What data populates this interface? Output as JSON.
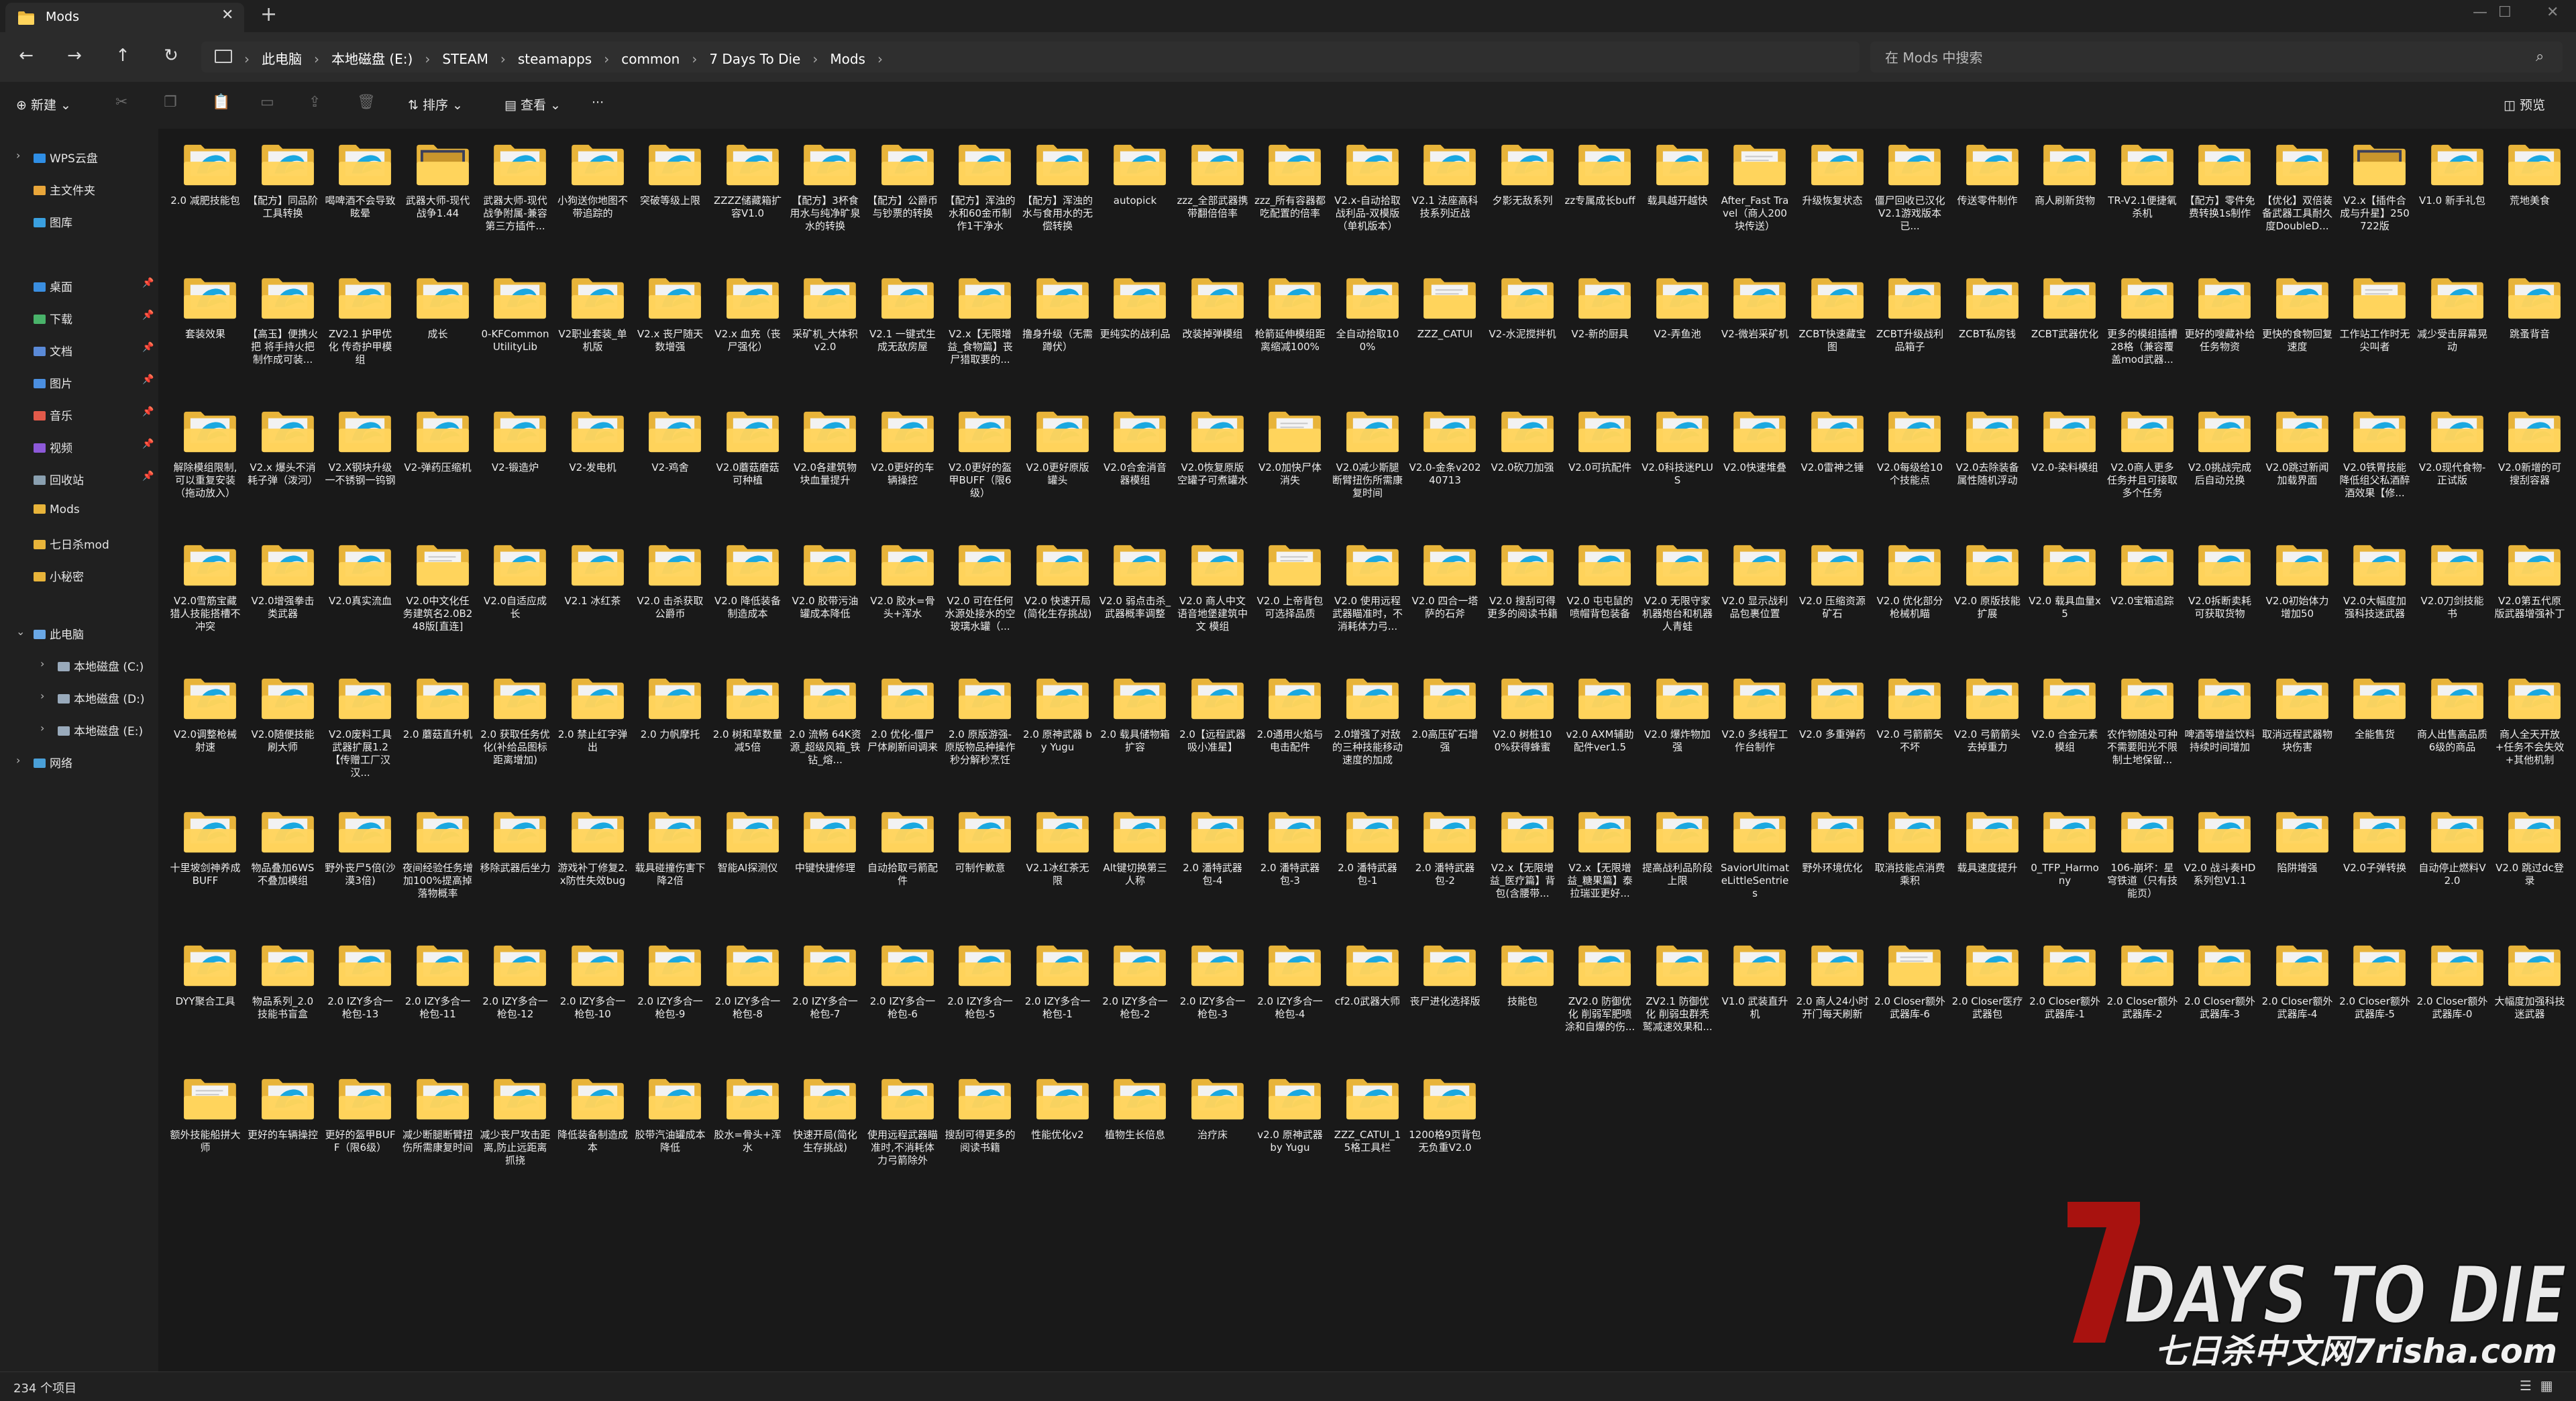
{
  "window": {
    "tab_title": "Mods",
    "tab_close": "✕",
    "new_tab": "+",
    "controls": [
      "—",
      "☐",
      "✕"
    ]
  },
  "address": {
    "crumbs": [
      "此电脑",
      "本地磁盘 (E:)",
      "STEAM",
      "steamapps",
      "common",
      "7 Days To Die",
      "Mods"
    ],
    "search_placeholder": "在 Mods 中搜索"
  },
  "toolbar": {
    "new_label": "新建",
    "sort_label": "排序",
    "view_label": "查看",
    "more_label": "···",
    "preview_label": "预览"
  },
  "sidebar": {
    "items": [
      {
        "label": "WPS云盘",
        "kind": "cloud"
      },
      {
        "label": "主文件夹",
        "kind": "home"
      },
      {
        "label": "图库",
        "kind": "gallery"
      },
      {
        "label": "桌面",
        "kind": "desktop",
        "pinned": true
      },
      {
        "label": "下载",
        "kind": "download",
        "pinned": true
      },
      {
        "label": "文档",
        "kind": "docs",
        "pinned": true
      },
      {
        "label": "图片",
        "kind": "pictures",
        "pinned": true
      },
      {
        "label": "音乐",
        "kind": "music",
        "pinned": true
      },
      {
        "label": "视频",
        "kind": "video",
        "pinned": true
      },
      {
        "label": "回收站",
        "kind": "recycle",
        "pinned": true
      },
      {
        "label": "Mods",
        "kind": "folder"
      },
      {
        "label": "七日杀mod",
        "kind": "folder"
      },
      {
        "label": "小秘密",
        "kind": "folder"
      },
      {
        "label": "此电脑",
        "kind": "pc"
      },
      {
        "label": "本地磁盘 (C:)",
        "kind": "drive"
      },
      {
        "label": "本地磁盘 (D:)",
        "kind": "drive"
      },
      {
        "label": "本地磁盘 (E:)",
        "kind": "drive"
      },
      {
        "label": "网络",
        "kind": "network"
      }
    ]
  },
  "folders": [
    {
      "name": "2.0 减肥技能包",
      "t": "e"
    },
    {
      "name": "【配方】同品阶工具转换",
      "t": "e"
    },
    {
      "name": "喝啤酒不会导致眩晕",
      "t": "e"
    },
    {
      "name": "武器大师-现代战争1.44",
      "t": "img"
    },
    {
      "name": "武器大师-现代战争附属-兼容第三方插件...",
      "t": "e"
    },
    {
      "name": "小狗送你地图不带追踪的",
      "t": "e"
    },
    {
      "name": "突破等级上限",
      "t": "e"
    },
    {
      "name": "ZZZZ储藏箱扩容V1.0",
      "t": "e"
    },
    {
      "name": "【配方】3杯食用水与纯净旷泉水的转换",
      "t": "e"
    },
    {
      "name": "【配方】公爵币与钞票的转换",
      "t": "e"
    },
    {
      "name": "【配方】浑浊的水和60金币制作1干净水",
      "t": "e"
    },
    {
      "name": "【配方】浑浊的水与食用水的无偿转换",
      "t": "e"
    },
    {
      "name": "autopick",
      "t": "e"
    },
    {
      "name": "zzz_全部武器携带翻倍倍率",
      "t": "e"
    },
    {
      "name": "zzz_所有容器都吃配置的倍率",
      "t": "e"
    },
    {
      "name": "V2.x-自动拾取战利品-双模版（单机版本）",
      "t": "e"
    },
    {
      "name": "V2.1 法座高科技系列近战",
      "t": "e"
    },
    {
      "name": "夕影无敌系列",
      "t": "e"
    },
    {
      "name": "zz专属成长buff",
      "t": "e"
    },
    {
      "name": "载具越开越快",
      "t": "e"
    },
    {
      "name": "After_Fast Travel（商人200块传送）",
      "t": "d"
    },
    {
      "name": "升级恢复状态",
      "t": "e"
    },
    {
      "name": "僵尸回收已汉化V2.1游戏版本 已...",
      "t": "e"
    },
    {
      "name": "传送零件制作",
      "t": "e"
    },
    {
      "name": "商人刷新货物",
      "t": "e"
    },
    {
      "name": "TR-V2.1便捷氧杀机",
      "t": "e"
    },
    {
      "name": "【配方】零件免费转换1s制作",
      "t": "e"
    },
    {
      "name": "【优化】双倍装备武器工具耐久度DoubleD...",
      "t": "e"
    },
    {
      "name": "V2.x【插件合成与升星】250722版",
      "t": "img"
    },
    {
      "name": "V1.0 新手礼包",
      "t": "e"
    },
    {
      "name": "荒地美食",
      "t": "e"
    },
    {
      "name": "套装效果",
      "t": "e"
    },
    {
      "name": "【高玉】便携火把 将手持火把制作成可装...",
      "t": "e"
    },
    {
      "name": "ZV2.1 护甲优化 传奇护甲模组",
      "t": "e"
    },
    {
      "name": "成长",
      "t": "e"
    },
    {
      "name": "0-KFCommonUtilityLib",
      "t": "e"
    },
    {
      "name": "V2职业套装_单机版",
      "t": "e"
    },
    {
      "name": "V2.x 丧尸随天数增强",
      "t": "e"
    },
    {
      "name": "V2.x 血充（丧尸强化）",
      "t": "e"
    },
    {
      "name": "采矿机_大体积 v2.0",
      "t": "e"
    },
    {
      "name": "V2.1 一键式生成无敌房屋",
      "t": "e"
    },
    {
      "name": "V2.x【无限增益_食物篇】丧尸猎取要的...",
      "t": "e"
    },
    {
      "name": "撸身升级（无需蹲伏）",
      "t": "e"
    },
    {
      "name": "更纯实的战利品",
      "t": "e"
    },
    {
      "name": "改装掉弹模组",
      "t": "e"
    },
    {
      "name": "枪箭延伸模组距离缩减100%",
      "t": "e"
    },
    {
      "name": "全自动拾取100%",
      "t": "e"
    },
    {
      "name": "ZZZ_CATUI",
      "t": "d"
    },
    {
      "name": "V2-水泥搅拌机",
      "t": "e"
    },
    {
      "name": "V2-新的厨具",
      "t": "e"
    },
    {
      "name": "V2-弄鱼池",
      "t": "e"
    },
    {
      "name": "V2-微岩采矿机",
      "t": "e"
    },
    {
      "name": "ZCBT快速藏宝图",
      "t": "e"
    },
    {
      "name": "ZCBT升级战利品箱子",
      "t": "e"
    },
    {
      "name": "ZCBT私房钱",
      "t": "e"
    },
    {
      "name": "ZCBT武器优化",
      "t": "e"
    },
    {
      "name": "更多的模组插槽28格（兼容覆盖mod武器...",
      "t": "e"
    },
    {
      "name": "更好的嗖藏补给任务物资",
      "t": "e"
    },
    {
      "name": "更快的食物回复速度",
      "t": "e"
    },
    {
      "name": "工作站工作时无尖叫者",
      "t": "d"
    },
    {
      "name": "减少受击屏幕晃动",
      "t": "e"
    },
    {
      "name": "跳蚤背音",
      "t": "e"
    },
    {
      "name": "解除模组限制,可以重复安装（拖动放入）",
      "t": "e"
    },
    {
      "name": "V2.x 爆头不消耗子弹（泼河）",
      "t": "e"
    },
    {
      "name": "V2.X钢块升级一不锈钢一钨钢",
      "t": "e"
    },
    {
      "name": "V2-弹药压缩机",
      "t": "e"
    },
    {
      "name": "V2-锻造炉",
      "t": "e"
    },
    {
      "name": "V2-发电机",
      "t": "e"
    },
    {
      "name": "V2-鸡舍",
      "t": "e"
    },
    {
      "name": "V2.0蘑菇磨菇可种植",
      "t": "e"
    },
    {
      "name": "V2.0各建筑物块血量提升",
      "t": "e"
    },
    {
      "name": "V2.0更好的车辆操控",
      "t": "e"
    },
    {
      "name": "V2.0更好的盔甲BUFF（限6级）",
      "t": "e"
    },
    {
      "name": "V2.0更好原版罐头",
      "t": "e"
    },
    {
      "name": "V2.0合金消音器模组",
      "t": "e"
    },
    {
      "name": "V2.0恢复原版空罐子可煮罐水",
      "t": "e"
    },
    {
      "name": "V2.0加快尸体消失",
      "t": "d"
    },
    {
      "name": "V2.0减少斯腿断臂扭伤所需康复时间",
      "t": "e"
    },
    {
      "name": "V2.0-金条v20240713",
      "t": "e"
    },
    {
      "name": "V2.0砍刀加强",
      "t": "e"
    },
    {
      "name": "V2.0可抗配件",
      "t": "e"
    },
    {
      "name": "V2.0科技迷PLUS",
      "t": "e"
    },
    {
      "name": "V2.0快速堆叠",
      "t": "e"
    },
    {
      "name": "V2.0雷神之锤",
      "t": "e"
    },
    {
      "name": "V2.0每级给10个技能点",
      "t": "e"
    },
    {
      "name": "V2.0去除装备属性随机浮动",
      "t": "e"
    },
    {
      "name": "V2.0-染料模组",
      "t": "e"
    },
    {
      "name": "V2.0商人更多任务并且可接取多个任务",
      "t": "e"
    },
    {
      "name": "V2.0挑战完成后自动兑换",
      "t": "e"
    },
    {
      "name": "V2.0跳过新闻加载界面",
      "t": "e"
    },
    {
      "name": "V2.0铁胃技能降低组父私酒醉酒效果【修...",
      "t": "e"
    },
    {
      "name": "V2.0现代食物-正试版",
      "t": "e"
    },
    {
      "name": "V2.0新增的可搜刮容器",
      "t": "e"
    },
    {
      "name": "V2.0雪筋宝藏猎人技能搭槽不冲突",
      "t": "e"
    },
    {
      "name": "V2.0增强拳击类武器",
      "t": "e"
    },
    {
      "name": "V2.0真实流血",
      "t": "e"
    },
    {
      "name": "V2.0中文化任务建筑名2.0B248版[直连]",
      "t": "d"
    },
    {
      "name": "V2.0自适应成长",
      "t": "e"
    },
    {
      "name": "V2.1 冰红茶",
      "t": "e"
    },
    {
      "name": "V2.0 击杀获取公爵币",
      "t": "e"
    },
    {
      "name": "V2.0 降低装备制造成本",
      "t": "e"
    },
    {
      "name": "V2.0 胶带污油罐成本降低",
      "t": "e"
    },
    {
      "name": "V2.0 胶水=骨头+浑水",
      "t": "e"
    },
    {
      "name": "V2.0 可在任何水源处接水的空玻璃水罐（...",
      "t": "e"
    },
    {
      "name": "V2.0 快速开局(简化生存挑战)",
      "t": "e"
    },
    {
      "name": "V2.0 弱点击杀_武器概率调整",
      "t": "e"
    },
    {
      "name": "V2.0 商人中文语音地堡建筑中文 模组",
      "t": "e"
    },
    {
      "name": "V2.0 上帝背包可选择品质",
      "t": "d"
    },
    {
      "name": "V2.0 使用远程武器瞄准时，不消耗体力弓...",
      "t": "e"
    },
    {
      "name": "V2.0 四合一塔萨的石斧",
      "t": "e"
    },
    {
      "name": "V2.0 搜刮可得更多的阅读书籍",
      "t": "e"
    },
    {
      "name": "V2.0 屯屯鼠的喷帽背包装备",
      "t": "e"
    },
    {
      "name": "V2.0 无限守家机器炮台和机器人青蛙",
      "t": "e"
    },
    {
      "name": "V2.0 显示战利品包裹位置",
      "t": "e"
    },
    {
      "name": "V2.0 压缩资源矿石",
      "t": "e"
    },
    {
      "name": "V2.0 优化部分枪械机瞄",
      "t": "e"
    },
    {
      "name": "V2.0 原版技能扩展",
      "t": "e"
    },
    {
      "name": "V2.0 载具血量x5",
      "t": "e"
    },
    {
      "name": "V2.0宝箱追踪",
      "t": "e"
    },
    {
      "name": "V2.0拆断卖耗可获取货物",
      "t": "e"
    },
    {
      "name": "V2.0初始体力增加50",
      "t": "e"
    },
    {
      "name": "V2.0大幅度加强科技迷武器",
      "t": "e"
    },
    {
      "name": "V2.0刀剑技能书",
      "t": "e"
    },
    {
      "name": "V2.0第五代原版武器增强补丁",
      "t": "e"
    },
    {
      "name": "V2.0调整枪械射速",
      "t": "e"
    },
    {
      "name": "V2.0随便技能刷大师",
      "t": "e"
    },
    {
      "name": "V2.0废料工具武器扩展1.2【传赠工厂汉汉...",
      "t": "e"
    },
    {
      "name": "2.0 蘑菇直升机",
      "t": "e"
    },
    {
      "name": "2.0 获取任务优化(补给品图标距离增加)",
      "t": "e"
    },
    {
      "name": "2.0 禁止红字弹出",
      "t": "e"
    },
    {
      "name": "2.0 力帆摩托",
      "t": "e"
    },
    {
      "name": "2.0 树和草数量减5倍",
      "t": "e"
    },
    {
      "name": "2.0 流畅 64K资源_超级风箱_铁钻_熔...",
      "t": "e"
    },
    {
      "name": "2.0 优化-僵尸尸体刷新间调来",
      "t": "e"
    },
    {
      "name": "2.0 原版游强-原版物品种操作秒分解秒烹饪",
      "t": "e"
    },
    {
      "name": "2.0 原神武器 by Yugu",
      "t": "e"
    },
    {
      "name": "2.0 载具储物箱扩容",
      "t": "e"
    },
    {
      "name": "2.0【远程武器吸小准星】",
      "t": "e"
    },
    {
      "name": "2.0通用火焰与电击配件",
      "t": "e"
    },
    {
      "name": "2.0增强了对敌的三种技能移动速度的加成",
      "t": "e"
    },
    {
      "name": "2.0高压矿石增强",
      "t": "e"
    },
    {
      "name": "V2.0 树桩100%获得蜂蜜",
      "t": "e"
    },
    {
      "name": "v2.0 AXM辅助配件ver1.5",
      "t": "e"
    },
    {
      "name": "V2.0 爆炸物加强",
      "t": "e"
    },
    {
      "name": "V2.0 多线程工作台制作",
      "t": "e"
    },
    {
      "name": "V2.0 多重弹药",
      "t": "e"
    },
    {
      "name": "V2.0 弓箭箭矢不坏",
      "t": "e"
    },
    {
      "name": "V2.0 弓箭箭头去掉重力",
      "t": "e"
    },
    {
      "name": "V2.0 合金元素模组",
      "t": "e"
    },
    {
      "name": "农作物随处可种不需要阳光不限制土地保留...",
      "t": "e"
    },
    {
      "name": "啤酒等增益饮料持续时间增加",
      "t": "e"
    },
    {
      "name": "取消远程武器物块伤害",
      "t": "e"
    },
    {
      "name": "全能售货",
      "t": "e"
    },
    {
      "name": "商人出售高品质6级的商品",
      "t": "e"
    },
    {
      "name": "商人全天开放+任务不会失效+其他机制",
      "t": "e"
    },
    {
      "name": "十里坡剑神养成BUFF",
      "t": "e"
    },
    {
      "name": "物品叠加6WS不叠加模组",
      "t": "e"
    },
    {
      "name": "野外丧尸5倍(沙漠3倍)",
      "t": "e"
    },
    {
      "name": "夜间经验任务增加100%提高掉落物概率",
      "t": "e"
    },
    {
      "name": "移除武器后坐力",
      "t": "e"
    },
    {
      "name": "游戏补丁修复2.x防性失效bug",
      "t": "e"
    },
    {
      "name": "载具碰撞伤害下降2倍",
      "t": "e"
    },
    {
      "name": "智能AI探测仪",
      "t": "e"
    },
    {
      "name": "中键快捷修理",
      "t": "e"
    },
    {
      "name": "自动拾取弓箭配件",
      "t": "e"
    },
    {
      "name": "可制作歉意",
      "t": "e"
    },
    {
      "name": "V2.1冰红茶无限",
      "t": "e"
    },
    {
      "name": "Alt键切换第三人称",
      "t": "e"
    },
    {
      "name": "2.0 潘特武器包-4",
      "t": "e"
    },
    {
      "name": "2.0 潘特武器包-3",
      "t": "e"
    },
    {
      "name": "2.0 潘特武器包-1",
      "t": "e"
    },
    {
      "name": "2.0 潘特武器包-2",
      "t": "e"
    },
    {
      "name": "V2.x【无限增益_医疗篇】背包(含腰带...",
      "t": "e"
    },
    {
      "name": "V2.x【无限增益_糖果篇】泰拉瑞亚更好...",
      "t": "e"
    },
    {
      "name": "提高战利品阶段上限",
      "t": "e"
    },
    {
      "name": "SaviorUltimateLittleSentries",
      "t": "e"
    },
    {
      "name": "野外环境优化",
      "t": "e"
    },
    {
      "name": "取消技能点消费乘积",
      "t": "e"
    },
    {
      "name": "载具速度提升",
      "t": "e"
    },
    {
      "name": "0_TFP_Harmony",
      "t": "e"
    },
    {
      "name": "106-崩坏：星穹铁道（只有技能页）",
      "t": "e"
    },
    {
      "name": "V2.0 战斗奏HD系列包V1.1",
      "t": "e"
    },
    {
      "name": "陷阱增强",
      "t": "e"
    },
    {
      "name": "V2.0子弹转换",
      "t": "e"
    },
    {
      "name": "自动停止燃料V2.0",
      "t": "e"
    },
    {
      "name": "V2.0 跳过dc登录",
      "t": "e"
    },
    {
      "name": "DYY聚合工具",
      "t": "e"
    },
    {
      "name": "物品系列_2.0 技能书盲盒",
      "t": "e"
    },
    {
      "name": "2.0 IZY多合一枪包-13",
      "t": "e"
    },
    {
      "name": "2.0 IZY多合一枪包-11",
      "t": "e"
    },
    {
      "name": "2.0 IZY多合一枪包-12",
      "t": "e"
    },
    {
      "name": "2.0 IZY多合一枪包-10",
      "t": "e"
    },
    {
      "name": "2.0 IZY多合一枪包-9",
      "t": "e"
    },
    {
      "name": "2.0 IZY多合一枪包-8",
      "t": "e"
    },
    {
      "name": "2.0 IZY多合一枪包-7",
      "t": "e"
    },
    {
      "name": "2.0 IZY多合一枪包-6",
      "t": "e"
    },
    {
      "name": "2.0 IZY多合一枪包-5",
      "t": "e"
    },
    {
      "name": "2.0 IZY多合一枪包-1",
      "t": "e"
    },
    {
      "name": "2.0 IZY多合一枪包-2",
      "t": "e"
    },
    {
      "name": "2.0 IZY多合一枪包-3",
      "t": "e"
    },
    {
      "name": "2.0 IZY多合一枪包-4",
      "t": "e"
    },
    {
      "name": "cf2.0武器大师",
      "t": "e"
    },
    {
      "name": "丧尸进化选择版",
      "t": "e"
    },
    {
      "name": "技能包",
      "t": "e"
    },
    {
      "name": "ZV2.0 防御优化 削弱军肥喷涂和自爆的伤...",
      "t": "e"
    },
    {
      "name": "ZV2.1 防御优化 削弱虫群秃鹫减速效果和...",
      "t": "e"
    },
    {
      "name": "V1.0 武装直升机",
      "t": "e"
    },
    {
      "name": "2.0 商人24小时开门每天刷新",
      "t": "e"
    },
    {
      "name": "2.0 Closer额外武器库-6",
      "t": "d"
    },
    {
      "name": "2.0 Closer医疗武器包",
      "t": "e"
    },
    {
      "name": "2.0 Closer额外武器库-1",
      "t": "e"
    },
    {
      "name": "2.0 Closer额外武器库-2",
      "t": "e"
    },
    {
      "name": "2.0 Closer额外武器库-3",
      "t": "e"
    },
    {
      "name": "2.0 Closer额外武器库-4",
      "t": "e"
    },
    {
      "name": "2.0 Closer额外武器库-5",
      "t": "e"
    },
    {
      "name": "2.0 Closer额外武器库-0",
      "t": "e"
    },
    {
      "name": "大幅度加强科技迷武器",
      "t": "e"
    },
    {
      "name": "额外技能船拼大师",
      "t": "d"
    },
    {
      "name": "更好的车辆操控",
      "t": "e"
    },
    {
      "name": "更好的盔甲BUFF（限6级）",
      "t": "e"
    },
    {
      "name": "减少断腿断臂扭伤所需康复时间",
      "t": "e"
    },
    {
      "name": "减少丧尸攻击距离,防止远距离抓挠",
      "t": "e"
    },
    {
      "name": "降低装备制造成本",
      "t": "e"
    },
    {
      "name": "胶带汽油罐成本降低",
      "t": "e"
    },
    {
      "name": "胶水=骨头+浑水",
      "t": "e"
    },
    {
      "name": "快速开局(简化生存挑战)",
      "t": "e"
    },
    {
      "name": "使用远程武器瞄准时,不消耗体力弓箭除外",
      "t": "e"
    },
    {
      "name": "搜刮可得更多的阅读书籍",
      "t": "e"
    },
    {
      "name": "性能优化v2",
      "t": "e"
    },
    {
      "name": "植物生长倍息",
      "t": "e"
    },
    {
      "name": "治疗床",
      "t": "e"
    },
    {
      "name": "v2.0 原神武器 by Yugu",
      "t": "e"
    },
    {
      "name": "ZZZ_CATUI_15格工具栏",
      "t": "e"
    },
    {
      "name": "1200格9页背包无负重V2.0",
      "t": "e"
    }
  ],
  "status": {
    "item_count": "234 个项目"
  },
  "watermark": {
    "logo_text": "7DAYS TO DIE",
    "site_text": "七日杀中文网7risha.com"
  },
  "colors": {
    "folder_back": "#E8B43A",
    "folder_front": "#FFD45C",
    "doc_blue": "#1AA8E0",
    "doc_green": "#3DBE8C",
    "background": "#191919"
  }
}
